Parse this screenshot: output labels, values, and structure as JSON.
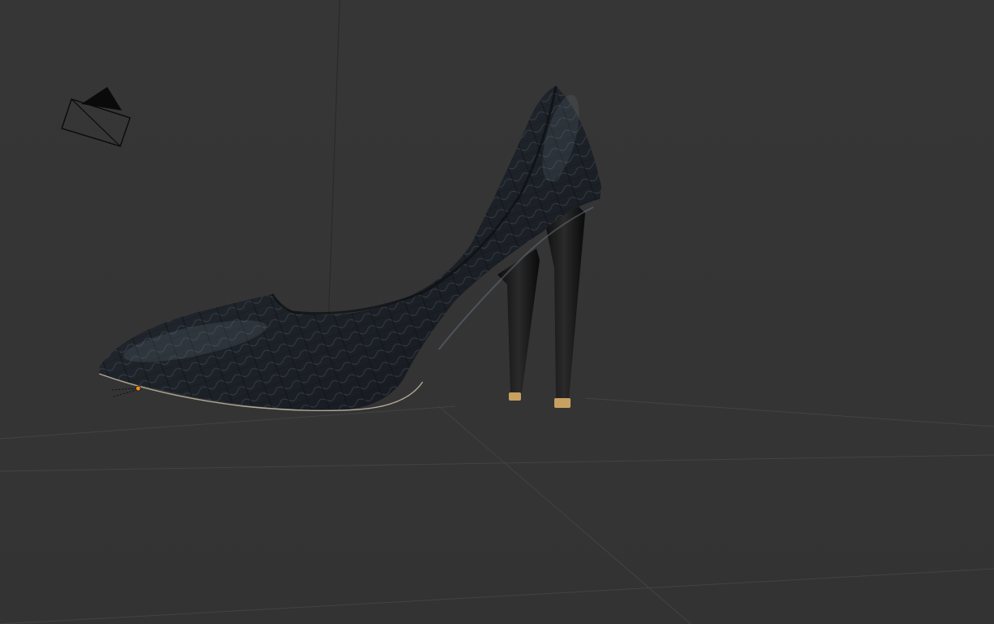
{
  "viewport": {
    "background": "#3a3a3a",
    "grid_color": "#4a4a4a",
    "axis_color": "#2a2a2a"
  },
  "scene": {
    "object": "high-heel-shoe",
    "material_color": "#1c2026",
    "highlight_color": "#5a6470",
    "heel_tip_color": "#c8a060",
    "origin_color": "#e8901a"
  },
  "camera": {
    "icon": "camera-icon"
  }
}
